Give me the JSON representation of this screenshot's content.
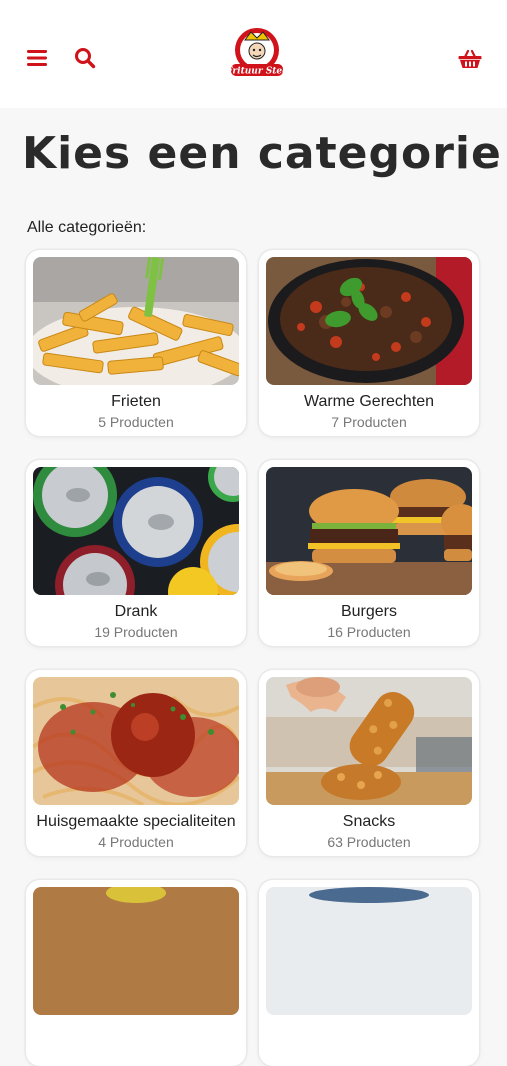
{
  "header": {
    "menu_icon": "hamburger-menu-icon",
    "search_icon": "search-icon",
    "cart_icon": "basket-icon",
    "logo_text": "Frituur Stee",
    "accent_color": "#d0121b"
  },
  "page": {
    "title": "Kies een categorie",
    "section_label": "Alle categorieën:"
  },
  "categories": [
    {
      "name": "Frieten",
      "count": "5 Producten"
    },
    {
      "name": "Warme Gerechten",
      "count": "7 Producten"
    },
    {
      "name": "Drank",
      "count": "19 Producten"
    },
    {
      "name": "Burgers",
      "count": "16 Producten"
    },
    {
      "name": "Huisgemaakte specialiteiten",
      "count": "4 Producten"
    },
    {
      "name": "Snacks",
      "count": "63 Producten"
    },
    {
      "name": "",
      "count": ""
    },
    {
      "name": "",
      "count": ""
    }
  ]
}
